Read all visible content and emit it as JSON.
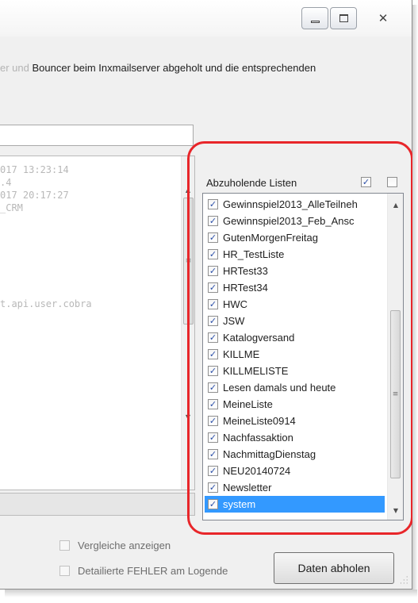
{
  "description": {
    "faded_prefix": "er und",
    "text": " Bouncer beim Inxmailserver abgeholt und die entsprechenden"
  },
  "log_lines": [
    "017 13:23:14",
    ".4",
    "017 20:17:27",
    "_CRM",
    "",
    "",
    "t.api.user.cobra"
  ],
  "lists_panel": {
    "title": "Abzuholende Listen",
    "select_all_checked": true,
    "select_none_checked": false,
    "items": [
      {
        "label": "Gewinnspiel2013_AlleTeilneh",
        "checked": true,
        "selected": false
      },
      {
        "label": "Gewinnspiel2013_Feb_Ansc",
        "checked": true,
        "selected": false
      },
      {
        "label": "GutenMorgenFreitag",
        "checked": true,
        "selected": false
      },
      {
        "label": "HR_TestListe",
        "checked": true,
        "selected": false
      },
      {
        "label": "HRTest33",
        "checked": true,
        "selected": false
      },
      {
        "label": "HRTest34",
        "checked": true,
        "selected": false
      },
      {
        "label": "HWC",
        "checked": true,
        "selected": false
      },
      {
        "label": "JSW",
        "checked": true,
        "selected": false
      },
      {
        "label": "Katalogversand",
        "checked": true,
        "selected": false
      },
      {
        "label": "KILLME",
        "checked": true,
        "selected": false
      },
      {
        "label": "KILLMELISTE",
        "checked": true,
        "selected": false
      },
      {
        "label": "Lesen damals und heute",
        "checked": true,
        "selected": false
      },
      {
        "label": "MeineListe",
        "checked": true,
        "selected": false
      },
      {
        "label": "MeineListe0914",
        "checked": true,
        "selected": false
      },
      {
        "label": "Nachfassaktion",
        "checked": true,
        "selected": false
      },
      {
        "label": "NachmittagDienstag",
        "checked": true,
        "selected": false
      },
      {
        "label": "NEU20140724",
        "checked": true,
        "selected": false
      },
      {
        "label": "Newsletter",
        "checked": true,
        "selected": false
      },
      {
        "label": "system",
        "checked": true,
        "selected": true
      }
    ]
  },
  "options": {
    "compare_label": "Vergleiche anzeigen",
    "compare_checked": false,
    "errors_label": "Detailierte FEHLER am Logende",
    "errors_checked": false
  },
  "fetch_button_label": "Daten abholen",
  "colors": {
    "highlight": "#e8262a",
    "selection": "#3399ff",
    "check": "#2b4fa8"
  }
}
